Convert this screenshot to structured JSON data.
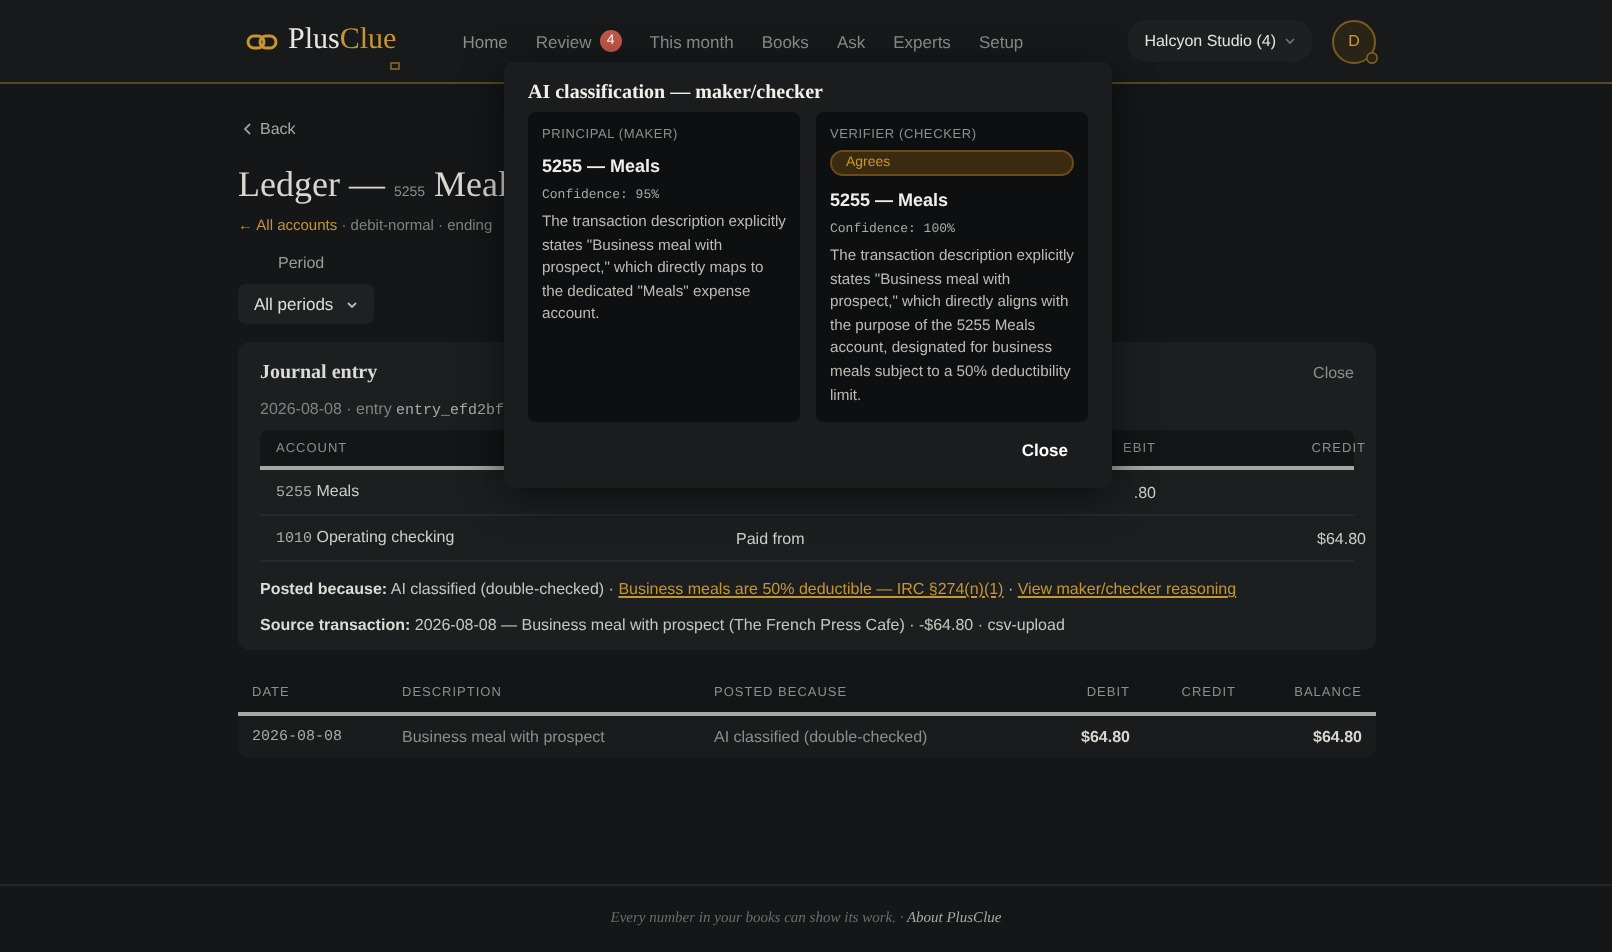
{
  "header": {
    "brand": {
      "name": "Plus",
      "accent": "Clue"
    },
    "nav": [
      {
        "label": "Home",
        "selected": false
      },
      {
        "label": "Review",
        "selected": false,
        "badge": "4"
      },
      {
        "label": "This month",
        "selected": false
      },
      {
        "label": "Books",
        "selected": false
      },
      {
        "label": "Ask",
        "selected": false
      },
      {
        "label": "Experts",
        "selected": false
      },
      {
        "label": "Setup",
        "selected": false
      }
    ],
    "workspace": "Halcyon Studio (4)",
    "avatar": "D"
  },
  "back": "Back",
  "title": {
    "main": "Ledger — ",
    "code": "5255",
    "name": "Meal"
  },
  "subline": {
    "link": "← All accounts",
    "rest": "· debit-normal · ending"
  },
  "period": {
    "label": "Period",
    "value": "All periods"
  },
  "journal": {
    "title": "Journal entry",
    "close": "Close",
    "meta": "2026-08-08 · entry",
    "entry_id": "entry_efd2bf",
    "columns": [
      "ACCOUNT",
      "",
      "EBIT",
      "CREDIT"
    ],
    "rows": [
      {
        "code": "5255",
        "account": "Meals",
        "role": "",
        "debit": ".80",
        "credit": ""
      },
      {
        "code": "1010",
        "account": "Operating checking",
        "role": "Paid from",
        "debit": "",
        "credit": "$64.80"
      }
    ],
    "posted": {
      "label": "Posted because:",
      "text": "AI classified (double-checked) ·",
      "separator": "·",
      "links": [
        "Business meals are 50% deductible — IRC §274(n)(1)",
        "View maker/checker reasoning"
      ]
    },
    "source": {
      "label": "Source transaction:",
      "text": "2026-08-08 — Business meal with prospect (The French Press Cafe) · -$64.80 · csv-upload"
    }
  },
  "ledger": {
    "columns": [
      "DATE",
      "DESCRIPTION",
      "POSTED BECAUSE",
      "DEBIT",
      "CREDIT",
      "BALANCE"
    ],
    "rows": [
      {
        "date": "2026-08-08",
        "description": "Business meal with prospect",
        "posted": "AI classified (double-checked)",
        "debit": "$64.80",
        "credit": "",
        "balance": "$64.80"
      }
    ]
  },
  "footer": {
    "text": "Every number in your books can show its work. ·",
    "link": "About PlusClue"
  },
  "modal": {
    "title": "AI classification — maker/checker",
    "cards": [
      {
        "role": "PRINCIPAL (MAKER)",
        "account": "5255 — Meals",
        "confidence": "Confidence: 95%",
        "reason": "The transaction description explicitly states \"Business meal with prospect,\" which directly maps to the dedicated \"Meals\" expense account."
      },
      {
        "role": "VERIFIER (CHECKER)",
        "verdict": "Agrees",
        "account": "5255 — Meals",
        "confidence": "Confidence: 100%",
        "reason": "The transaction description explicitly states \"Business meal with prospect,\" which directly aligns with the purpose of the 5255 Meals account, designated for business meals subject to a 50% deductibility limit."
      }
    ],
    "close": "Close"
  }
}
